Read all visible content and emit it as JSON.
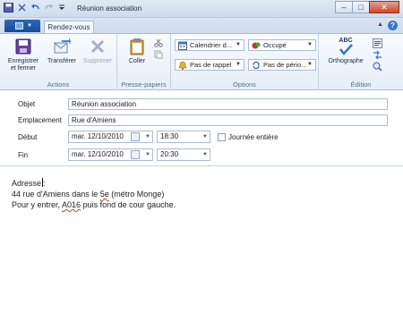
{
  "window": {
    "title": "Réunion association",
    "min": "–",
    "max": "□",
    "close": "✕"
  },
  "tabs": {
    "active": "Rendez-vous"
  },
  "ribbon": {
    "actions": {
      "label": "Actions",
      "save": "Enregistrer",
      "save2": "et fermer",
      "forward": "Transférer",
      "delete": "Supprimer"
    },
    "clipboard": {
      "label": "Presse-papiers",
      "paste": "Coller"
    },
    "options": {
      "label": "Options",
      "calendar": "Calendrier d...",
      "busy": "Occupé",
      "reminder": "Pas de rappel",
      "recurrence": "Pas de pério..."
    },
    "edition": {
      "label": "Édition",
      "spelling": "Orthographe",
      "abc": "ABC"
    }
  },
  "form": {
    "subject_label": "Objet",
    "subject_value": "Réunion association",
    "location_label": "Emplacement",
    "location_value": "Rue d'Amiens",
    "start_label": "Début",
    "start_date": "mar. 12/10/2010",
    "start_time": "18:30",
    "allday_label": "Journée entière",
    "end_label": "Fin",
    "end_date": "mar. 12/10/2010",
    "end_time": "20:30"
  },
  "body": {
    "line1": "Adresse",
    "line1_end": ":",
    "line2_a": "44 rue d'Amiens dans le ",
    "line2_b": "5e",
    "line2_c": " (métro Monge)",
    "line3_a": "Pour y entrer, ",
    "line3_b": "A016",
    "line3_c": " puis fond de cour gauche."
  }
}
